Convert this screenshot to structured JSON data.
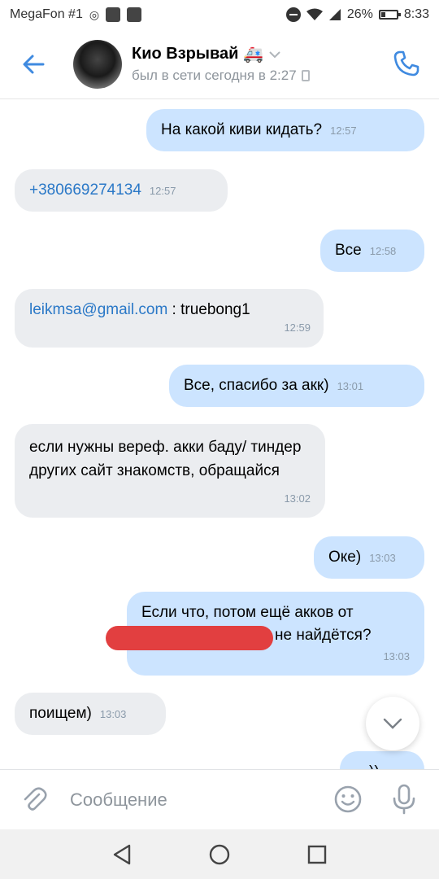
{
  "statusbar": {
    "carrier": "MegaFon #1",
    "battery": "26%",
    "time": "8:33"
  },
  "header": {
    "name": "Кио Взрывай",
    "name_emoji": "🚑",
    "status": "был в сети сегодня в 2:27"
  },
  "messages": [
    {
      "dir": "out",
      "text": "На какой киви кидать?",
      "time": "12:57"
    },
    {
      "dir": "in",
      "text": "+380669274134",
      "time": "12:57"
    },
    {
      "dir": "out",
      "text": "Все",
      "time": "12:58"
    },
    {
      "dir": "in",
      "link": "leikmsa@gmail.com",
      "text": " : truebong1",
      "time": "12:59"
    },
    {
      "dir": "out",
      "text": "Все, спасибо за акк)",
      "time": "13:01"
    },
    {
      "dir": "in",
      "text": "если нужны вереф. акки баду/ тиндер других сайт знакомств, обращайся",
      "time": "13:02"
    },
    {
      "dir": "out",
      "text": "Оке)",
      "time": "13:03"
    },
    {
      "dir": "out",
      "line1": "Если что, потом ещё акков от",
      "line2": "не найдётся?",
      "time": "13:03"
    },
    {
      "dir": "in",
      "text": "поищем)",
      "time": "13:03"
    },
    {
      "dir": "out",
      "text": "))",
      "time": ""
    }
  ],
  "composer": {
    "placeholder": "Сообщение"
  },
  "colors": {
    "outgoing_bubble": "#cce4ff",
    "incoming_bubble": "#ebedf0",
    "accent": "#2a78c7",
    "redaction": "#e23f40"
  },
  "icons": [
    "back-arrow-icon",
    "phone-call-icon",
    "attach-clip-icon",
    "emoji-icon",
    "microphone-icon",
    "chevron-down-icon",
    "nav-back-icon",
    "nav-home-icon",
    "nav-recents-icon"
  ]
}
